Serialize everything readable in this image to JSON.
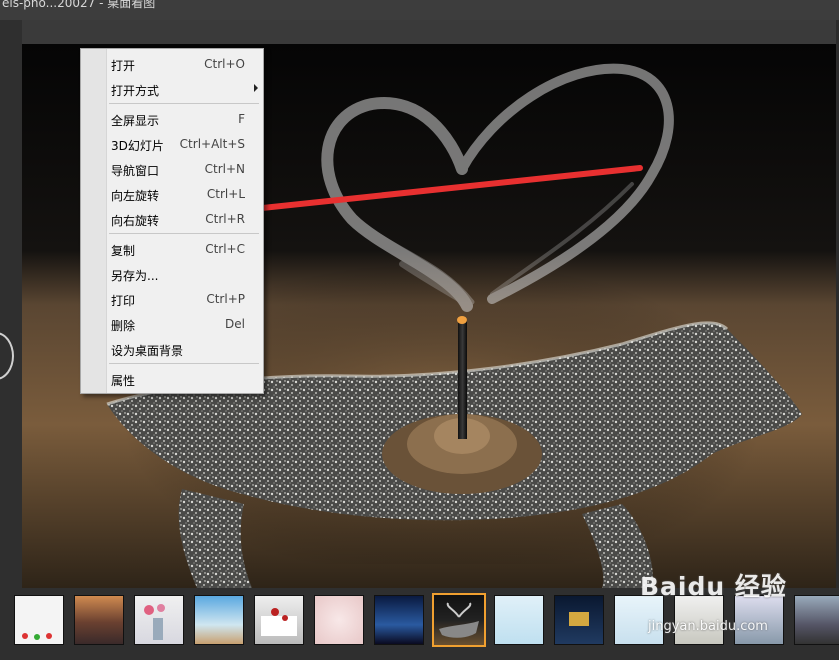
{
  "window": {
    "title": "els-pho...20027 - 桌面看图"
  },
  "context_menu": {
    "items": [
      {
        "label": "打开",
        "shortcut": "Ctrl+O"
      },
      {
        "label": "打开方式",
        "shortcut": ""
      },
      {
        "label": "全屏显示",
        "shortcut": "F"
      },
      {
        "label": "3D幻灯片",
        "shortcut": "Ctrl+Alt+S"
      },
      {
        "label": "导航窗口",
        "shortcut": "Ctrl+N"
      },
      {
        "label": "向左旋转",
        "shortcut": "Ctrl+L"
      },
      {
        "label": "向右旋转",
        "shortcut": "Ctrl+R"
      },
      {
        "label": "复制",
        "shortcut": "Ctrl+C"
      },
      {
        "label": "另存为...",
        "shortcut": ""
      },
      {
        "label": "打印",
        "shortcut": "Ctrl+P"
      },
      {
        "label": "删除",
        "shortcut": "Del"
      },
      {
        "label": "设为桌面背景",
        "shortcut": ""
      },
      {
        "label": "属性",
        "shortcut": ""
      }
    ]
  },
  "thumbnails": {
    "count": 14,
    "active_index": 7
  },
  "watermark": {
    "logo": "Baidu 经验",
    "url": "jingyan.baidu.com"
  },
  "colors": {
    "accent_active_thumb": "#f0a030",
    "annotation_arrow": "#e83030",
    "menu_bg": "#f0f0f0"
  },
  "icons": {
    "submenu": "chevron-right-icon",
    "nav_prev": "circle-prev-icon"
  }
}
